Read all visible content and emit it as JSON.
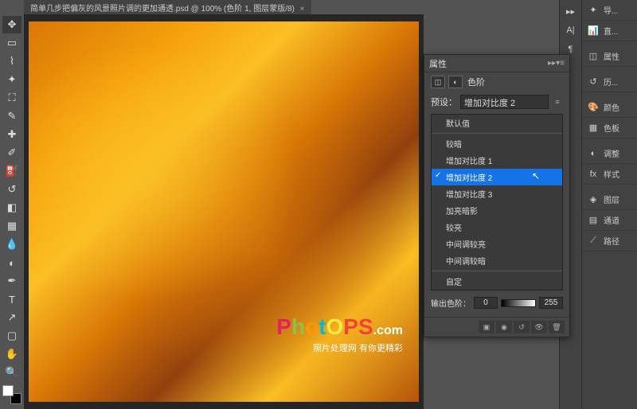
{
  "tab": {
    "filename": "简单几步把偏灰的风景照片调的更加通透.psd @ 100% (色阶 1, 图层蒙版/8)",
    "close": "×"
  },
  "tools": [
    "move",
    "marquee",
    "lasso",
    "wand",
    "crop",
    "eyedropper",
    "healing",
    "brush",
    "stamp",
    "history-brush",
    "eraser",
    "gradient",
    "blur",
    "dodge",
    "pen",
    "type",
    "path",
    "shape",
    "hand",
    "zoom"
  ],
  "properties": {
    "title": "属性",
    "adj_name": "色阶",
    "preset_label": "预设：",
    "preset_value": "增加对比度 2",
    "options": {
      "default": "默认值",
      "darker": "较暗",
      "contrast1": "增加对比度 1",
      "contrast2": "增加对比度 2",
      "contrast3": "增加对比度 3",
      "brighten": "加亮暗影",
      "lighter": "较亮",
      "midbright": "中间调较亮",
      "middark": "中间调较暗",
      "custom": "自定"
    },
    "output_label": "输出色阶：",
    "output_min": "0",
    "output_max": "255"
  },
  "right_panels": {
    "guide": "导...",
    "line": "直...",
    "attrs": "属性",
    "history": "历...",
    "color": "颜色",
    "swatches": "色板",
    "adjust": "调整",
    "styles": "样式",
    "layers": "图层",
    "channels": "通道",
    "paths": "路径"
  },
  "watermark": {
    "main_prefix": "Phot",
    "main_suffix": "PS",
    "dotcom": ".com",
    "sub": "照片处理网 有你更精彩"
  }
}
